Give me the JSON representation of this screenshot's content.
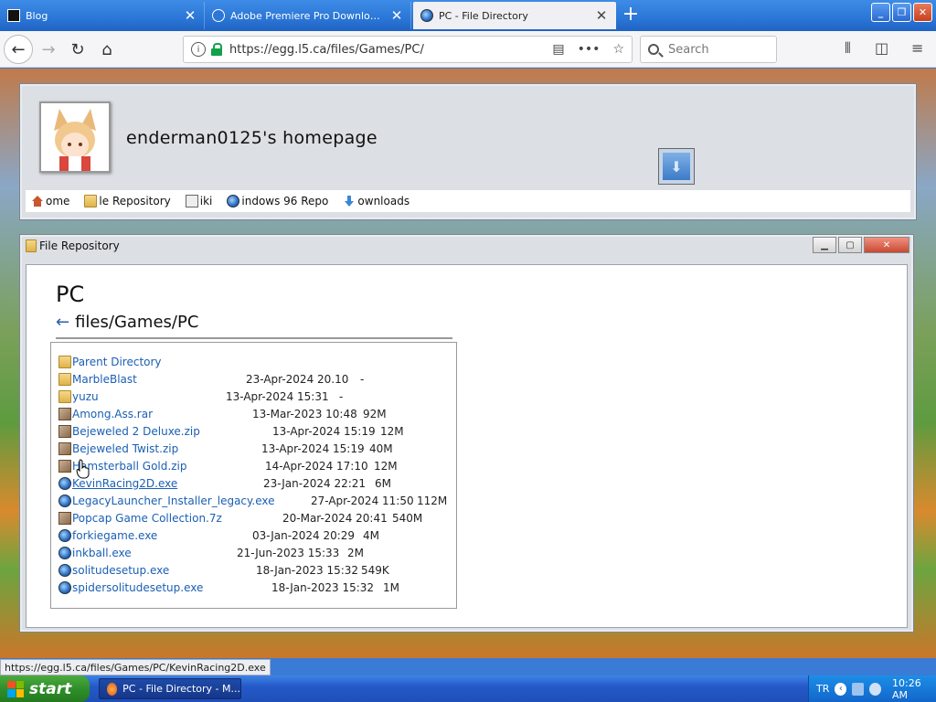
{
  "browser": {
    "tabs": [
      {
        "title": "Blog",
        "active": false
      },
      {
        "title": "Adobe Premiere Pro Download &amp; I",
        "active": false
      },
      {
        "title": "PC - File Directory",
        "active": true
      }
    ],
    "url": "https://egg.l5.ca/files/Games/PC/",
    "search_placeholder": "Search"
  },
  "site": {
    "title": "enderman0125's homepage",
    "nav": [
      {
        "label": "ome",
        "icon": "home-icon"
      },
      {
        "label": "le Repository",
        "icon": "folder-icon"
      },
      {
        "label": "iki",
        "icon": "book-icon"
      },
      {
        "label": "indows 96 Repo",
        "icon": "globe-icon"
      },
      {
        "label": "ownloads",
        "icon": "download-icon"
      }
    ]
  },
  "repo": {
    "window_title": "File Repository",
    "heading": "PC",
    "path": "files/Games/PC",
    "back_arrow": "←",
    "files": [
      {
        "name": "Parent Directory",
        "date": "",
        "size": "",
        "type": "parent"
      },
      {
        "name": "MarbleBlast",
        "date": "23-Apr-2024 20.10",
        "size": "-",
        "type": "folder"
      },
      {
        "name": "yuzu",
        "date": "13-Apr-2024 15:31",
        "size": "-",
        "type": "folder"
      },
      {
        "name": "Among.Ass.rar",
        "date": "13-Mar-2023 10:48",
        "size": "92M",
        "type": "archive"
      },
      {
        "name": "Bejeweled 2 Deluxe.zip",
        "date": "13-Apr-2024 15:19",
        "size": "12M",
        "type": "archive"
      },
      {
        "name": "Bejeweled Twist.zip",
        "date": "13-Apr-2024 15:19",
        "size": "40M",
        "type": "archive"
      },
      {
        "name": "Hamsterball Gold.zip",
        "date": "14-Apr-2024 17:10",
        "size": "12M",
        "type": "archive"
      },
      {
        "name": "KevinRacing2D.exe",
        "date": "23-Jan-2024 22:21",
        "size": "6M",
        "type": "exe"
      },
      {
        "name": "LegacyLauncher_Installer_legacy.exe",
        "date": "27-Apr-2024 11:50",
        "size": "112M",
        "type": "exe"
      },
      {
        "name": "Popcap Game Collection.7z",
        "date": "20-Mar-2024 20:41",
        "size": "540M",
        "type": "archive"
      },
      {
        "name": "forkiegame.exe",
        "date": "03-Jan-2024 20:29",
        "size": "4M",
        "type": "exe"
      },
      {
        "name": "inkball.exe",
        "date": "21-Jun-2023 15:33",
        "size": "2M",
        "type": "exe"
      },
      {
        "name": "solitudesetup.exe",
        "date": "18-Jan-2023 15:32",
        "size": "549K",
        "type": "exe"
      },
      {
        "name": "spidersolitudesetup.exe",
        "date": "18-Jan-2023 15:32",
        "size": "1M",
        "type": "exe"
      }
    ]
  },
  "statusbar": {
    "text": "https://egg.l5.ca/files/Games/PC/KevinRacing2D.exe"
  },
  "taskbar": {
    "start_label": "start",
    "task_label": "PC - File Directory - M...",
    "tray_lang": "TR",
    "clock": "10:26 AM"
  }
}
